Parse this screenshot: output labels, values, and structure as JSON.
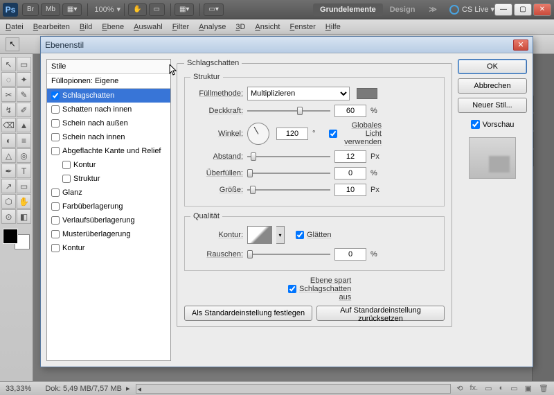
{
  "titlebar": {
    "zoom": "100%",
    "workspace_active": "Grundelemente",
    "workspace_2": "Design",
    "cslive": "CS Live"
  },
  "menu": [
    "Datei",
    "Bearbeiten",
    "Bild",
    "Ebene",
    "Auswahl",
    "Filter",
    "Analyse",
    "3D",
    "Ansicht",
    "Fenster",
    "Hilfe"
  ],
  "dialog": {
    "title": "Ebenenstil",
    "styles_header": "Stile",
    "blend_header": "Füllopionen: Eigene",
    "items": [
      {
        "label": "Schlagschatten",
        "checked": true,
        "selected": true
      },
      {
        "label": "Schatten nach innen",
        "checked": false
      },
      {
        "label": "Schein nach außen",
        "checked": false
      },
      {
        "label": "Schein nach innen",
        "checked": false
      },
      {
        "label": "Abgeflachte Kante und Relief",
        "checked": false
      },
      {
        "label": "Kontur",
        "checked": false,
        "indent": true
      },
      {
        "label": "Struktur",
        "checked": false,
        "indent": true
      },
      {
        "label": "Glanz",
        "checked": false
      },
      {
        "label": "Farbüberlagerung",
        "checked": false
      },
      {
        "label": "Verlaufsüberlagerung",
        "checked": false
      },
      {
        "label": "Musterüberlagerung",
        "checked": false
      },
      {
        "label": "Kontur",
        "checked": false
      }
    ],
    "main_heading": "Schlagschatten",
    "struct_heading": "Struktur",
    "fill_label": "Füllmethode:",
    "fill_value": "Multiplizieren",
    "opacity_label": "Deckkraft:",
    "opacity_val": "60",
    "pct": "%",
    "angle_label": "Winkel:",
    "angle_val": "120",
    "deg": "°",
    "global_light": "Globales Licht verwenden",
    "distance_label": "Abstand:",
    "distance_val": "12",
    "px": "Px",
    "spread_label": "Überfüllen:",
    "spread_val": "0",
    "size_label": "Größe:",
    "size_val": "10",
    "quality_heading": "Qualität",
    "contour_label": "Kontur:",
    "aa_label": "Glätten",
    "noise_label": "Rauschen:",
    "noise_val": "0",
    "knockout": "Ebene spart Schlagschatten aus",
    "make_default": "Als Standardeinstellung festlegen",
    "reset_default": "Auf Standardeinstellung zurücksetzen",
    "ok": "OK",
    "cancel": "Abbrechen",
    "new_style": "Neuer Stil...",
    "preview": "Vorschau"
  },
  "status": {
    "zoom": "33,33%",
    "doc": "Dok: 5,49 MB/7,57 MB"
  }
}
